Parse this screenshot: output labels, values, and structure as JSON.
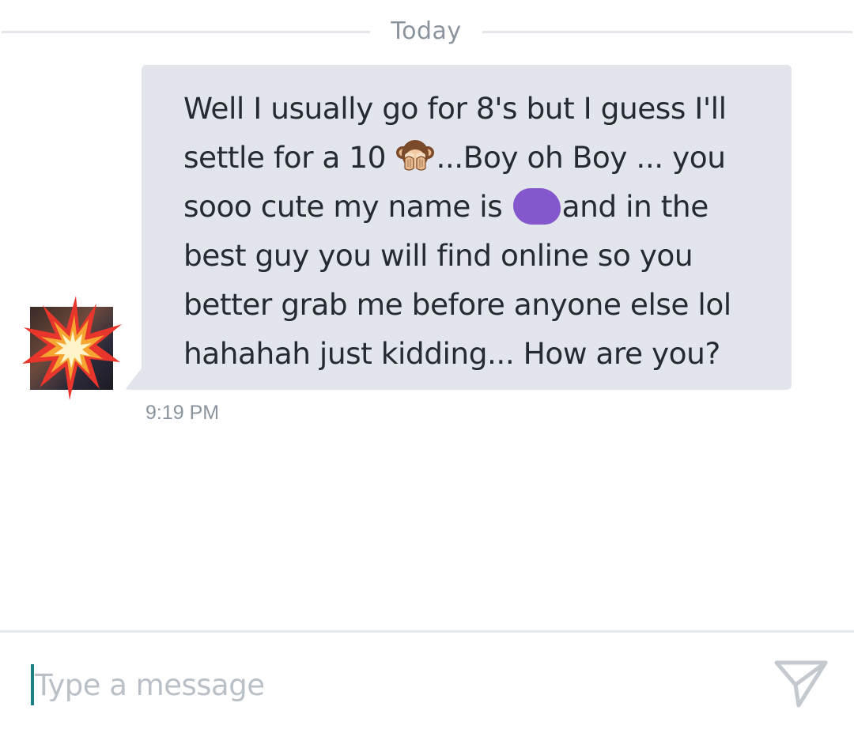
{
  "divider": {
    "date_label": "Today"
  },
  "message": {
    "text_part1": "Well I usually go for 8's but I guess I'll\nsettle for a 10 ",
    "emoji": "speak-no-evil-monkey",
    "text_part2": "...Boy oh Boy ... you\nsooo cute my name is ",
    "text_part3": "and in the\nbest guy you will find online so you\nbetter grab me before anyone else lol\nhahahah just kidding... How are you?",
    "timestamp": "9:19 PM",
    "redaction_color": "#8457cc",
    "bubble_color": "#e2e5ec"
  },
  "avatar": {
    "overlay_icon": "collision-icon"
  },
  "composer": {
    "placeholder": "Type a message",
    "value": "",
    "send_icon": "send-icon",
    "caret_color": "#1a7f86"
  }
}
